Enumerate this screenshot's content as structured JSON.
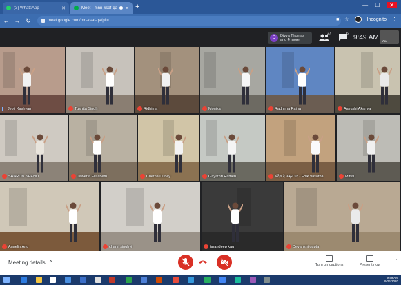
{
  "browser": {
    "tabs": [
      {
        "label": "(3) WhatsApp",
        "favicon_color": "#25d366",
        "active": false
      },
      {
        "label": "Meet - mnri-ksaf-qa",
        "favicon_color": "#00ac47",
        "active": true
      }
    ],
    "url": "meet.google.com/mri-ksaf-qa/pli=1",
    "profile_label": "Incognito"
  },
  "meet_header": {
    "presenter_chip_line1": "Divya Thomas",
    "presenter_chip_line2": "and 4 more",
    "presenter_initial": "D",
    "people_count": "27",
    "chat_count": "6",
    "time": "9:49 AM",
    "self_label": "You"
  },
  "participants": [
    {
      "name": "Jyoti Kashyap",
      "status": "speaking",
      "wall": "#b89c8c",
      "floor": "#6e4d44",
      "shirt": "#f2f2f2"
    },
    {
      "name": "Tushita Singh",
      "status": "muted",
      "wall": "#c7c2bb",
      "floor": "#8a7e72",
      "shirt": "#ffffff"
    },
    {
      "name": "Ridhima",
      "status": "muted",
      "wall": "#a3917d",
      "floor": "#5c4a3c",
      "shirt": "#f0f0f0"
    },
    {
      "name": "Monika",
      "status": "muted",
      "wall": "#a7a7a1",
      "floor": "#6d6a62",
      "shirt": "#f6f6f6"
    },
    {
      "name": "Radhima Raina",
      "status": "muted",
      "wall": "#5f86c2",
      "floor": "#6b5d52",
      "shirt": "#ffffff"
    },
    {
      "name": "Aayushi Akanya",
      "status": "muted",
      "wall": "#c9c3b0",
      "floor": "#4e4a3f",
      "shirt": "#e9e9e9"
    },
    {
      "name": "SHARON SEENU",
      "status": "muted",
      "wall": "#cfcac2",
      "floor": "#8c8378",
      "shirt": "#e8e4dc"
    },
    {
      "name": "Jaweria Elizabeth",
      "status": "muted",
      "wall": "#b9b1a2",
      "floor": "#7d6f5e",
      "shirt": "#ffffff"
    },
    {
      "name": "Chetna Dubey",
      "status": "muted",
      "wall": "#d1c5a7",
      "floor": "#8b7252",
      "shirt": "#f3f3f3"
    },
    {
      "name": "Gayathri Ramen",
      "status": "muted",
      "wall": "#c5c9c4",
      "floor": "#6a6960",
      "shirt": "#f4f4f4"
    },
    {
      "name": "संदेश दे अमृत घर - Folk Vasatha",
      "status": "muted",
      "wall": "#c2a27e",
      "floor": "#7a5e44",
      "shirt": "#fafafa"
    },
    {
      "name": "Mittal",
      "status": "muted",
      "wall": "#bdbcb6",
      "floor": "#5e5b53",
      "shirt": "#f0f0f0"
    },
    {
      "name": "Angelin Anu",
      "status": "muted",
      "wall": "#d0c8b8",
      "floor": "#7c5a3c",
      "shirt": "#ffffff"
    },
    {
      "name": "charvi singhvi",
      "status": "muted",
      "wall": "#d2cfc9",
      "floor": "#9a9288",
      "shirt": "#ffffff"
    },
    {
      "name": "tarandeep kau",
      "status": "muted",
      "wall": "#3a3a3a",
      "floor": "#2a2a2a",
      "shirt": "#ffffff"
    },
    {
      "name": "Devanshi gupta",
      "status": "muted",
      "wall": "#b9a993",
      "floor": "#9c8a70",
      "shirt": "#eaeaea"
    }
  ],
  "bottom_bar": {
    "meeting_details": "Meeting details",
    "captions": "Turn on captions",
    "present": "Present now"
  },
  "taskbar": {
    "time": "9:49 AM",
    "date": "9/26/2020"
  },
  "colors": {
    "danger": "#d93025",
    "meet_bg": "#202124",
    "chrome_blue": "#2b5797"
  }
}
